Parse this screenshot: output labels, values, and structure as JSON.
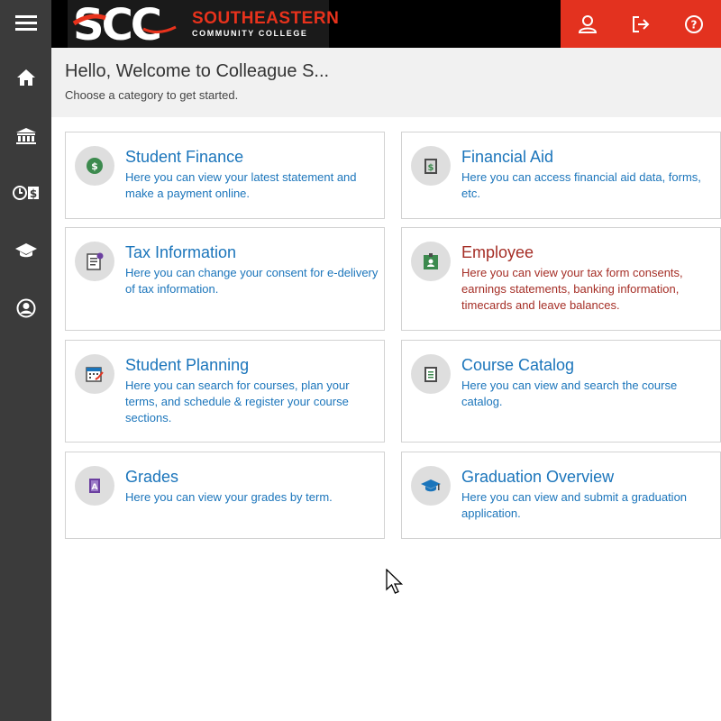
{
  "app": {
    "title": "Hello, Welcome to Colleague S...",
    "subtitle": "Choose a category to get started."
  },
  "logo": {
    "letters": "SCC",
    "line1": "SOUTHEASTERN",
    "line2": "COMMUNITY COLLEGE"
  },
  "sidebar": {
    "items": [
      {
        "name": "menu",
        "icon": "hamburger-icon"
      },
      {
        "name": "home",
        "icon": "home-icon"
      },
      {
        "name": "institution",
        "icon": "bank-icon"
      },
      {
        "name": "finance",
        "icon": "clock-dollar-icon"
      },
      {
        "name": "academics",
        "icon": "graduation-cap-icon"
      },
      {
        "name": "profile",
        "icon": "user-circle-icon"
      }
    ]
  },
  "header": {
    "actions": [
      {
        "icon": "user-icon"
      },
      {
        "icon": "sign-out-icon"
      },
      {
        "icon": "help-icon"
      }
    ]
  },
  "colors": {
    "accent_red": "#e3321f",
    "link_blue": "#1b75bb",
    "employee_red": "#a52e26",
    "sidebar": "#3b3b3b"
  },
  "cards": [
    {
      "title": "Student Finance",
      "description": "Here you can view your latest statement and make a payment online.",
      "icon": "money-icon"
    },
    {
      "title": "Financial Aid",
      "description": "Here you can access financial aid data, forms, etc.",
      "icon": "document-dollar-icon"
    },
    {
      "title": "Tax Information",
      "description": "Here you can change your consent for e-delivery of tax information.",
      "icon": "tax-form-icon"
    },
    {
      "title": "Employee",
      "description": "Here you can view your tax form consents, earnings statements, banking information, timecards and leave balances.",
      "icon": "id-badge-icon"
    },
    {
      "title": "Student Planning",
      "description": "Here you can search for courses, plan your terms, and schedule & register your course sections.",
      "icon": "calendar-icon"
    },
    {
      "title": "Course Catalog",
      "description": "Here you can view and search the course catalog.",
      "icon": "catalog-book-icon"
    },
    {
      "title": "Grades",
      "description": "Here you can view your grades by term.",
      "icon": "grades-icon"
    },
    {
      "title": "Graduation Overview",
      "description": "Here you can view and submit a graduation application.",
      "icon": "mortarboard-icon"
    }
  ]
}
